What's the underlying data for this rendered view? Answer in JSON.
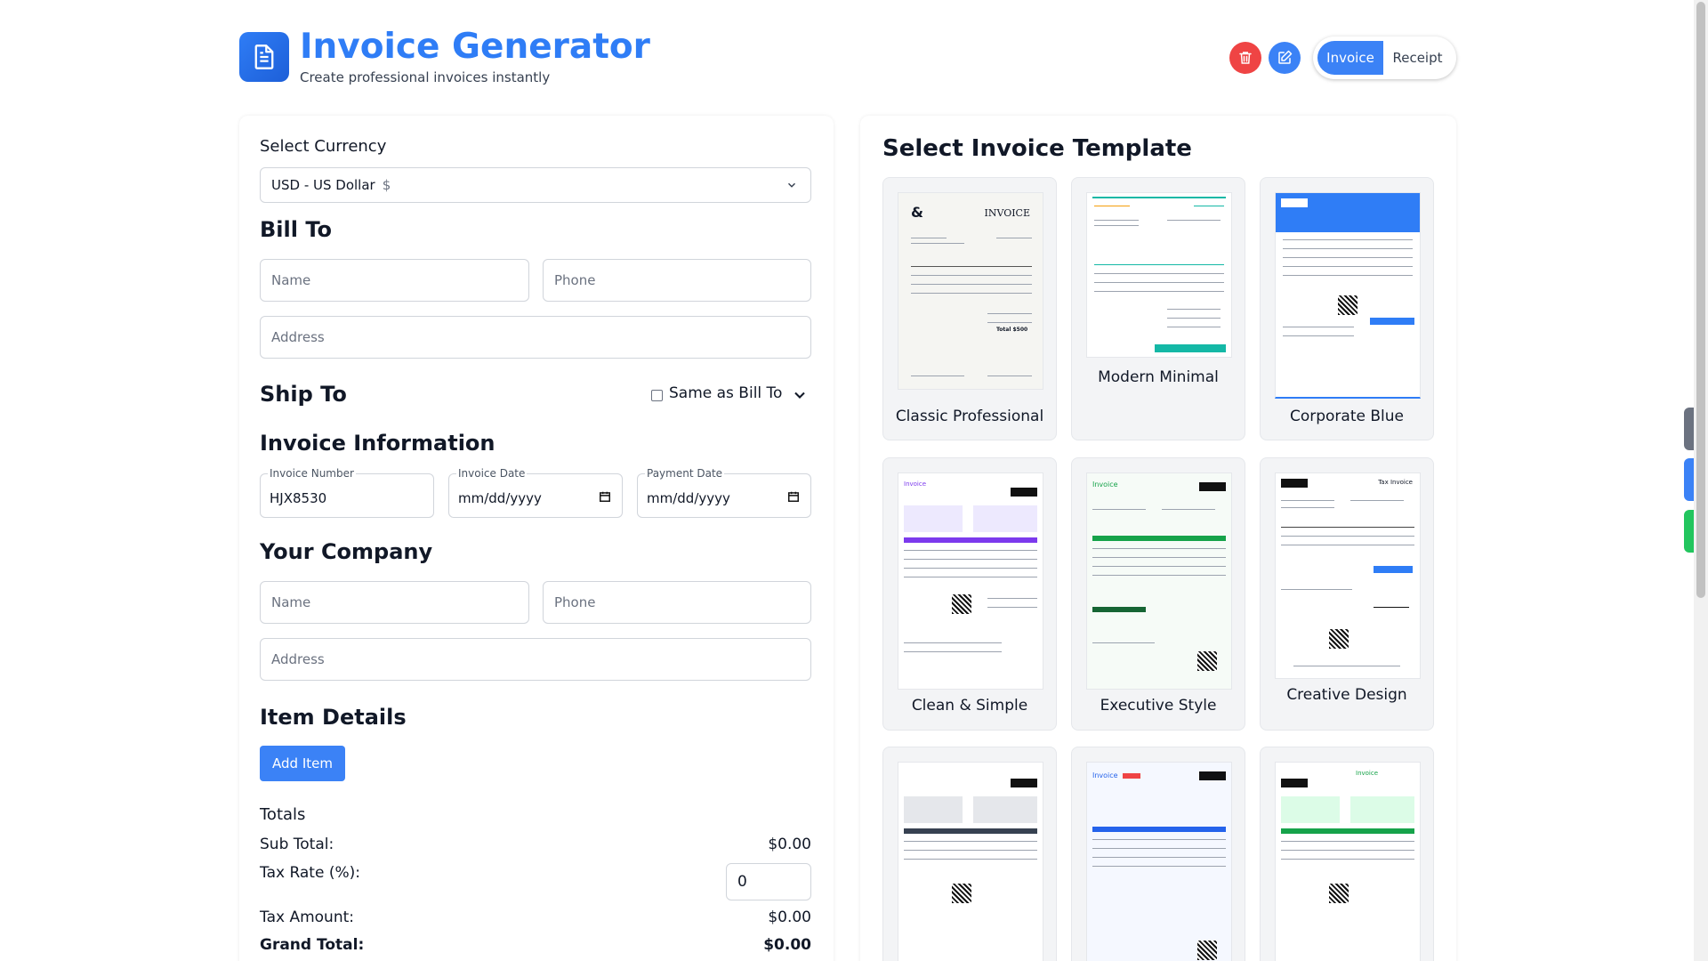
{
  "header": {
    "title": "Invoice Generator",
    "subtitle": "Create professional invoices instantly",
    "toggle": {
      "invoice": "Invoice",
      "receipt": "Receipt",
      "active": "Invoice"
    }
  },
  "form": {
    "currency_label": "Select Currency",
    "currency_value": "USD - US Dollar",
    "currency_symbol": "$",
    "bill_to": {
      "heading": "Bill To",
      "name_placeholder": "Name",
      "phone_placeholder": "Phone",
      "address_placeholder": "Address"
    },
    "ship_to": {
      "heading": "Ship To",
      "same_as_label": "Same as Bill To"
    },
    "invoice_info": {
      "heading": "Invoice Information",
      "number_label": "Invoice Number",
      "number_value": "HJX8530",
      "date_label": "Invoice Date",
      "date_value": "mm/dd/yyyy",
      "payment_label": "Payment Date",
      "payment_value": "mm/dd/yyyy"
    },
    "company": {
      "heading": "Your Company",
      "name_placeholder": "Name",
      "phone_placeholder": "Phone",
      "address_placeholder": "Address"
    },
    "items": {
      "heading": "Item Details",
      "add_button": "Add Item"
    },
    "totals": {
      "heading": "Totals",
      "subtotal_label": "Sub Total:",
      "subtotal_value": "$0.00",
      "tax_rate_label": "Tax Rate (%):",
      "tax_rate_value": "0",
      "tax_amount_label": "Tax Amount:",
      "tax_amount_value": "$0.00",
      "grand_total_label": "Grand Total:",
      "grand_total_value": "$0.00"
    }
  },
  "templates": {
    "heading": "Select Invoice Template",
    "items": [
      {
        "label": "Classic Professional"
      },
      {
        "label": "Modern Minimal"
      },
      {
        "label": "Corporate Blue"
      },
      {
        "label": "Clean & Simple"
      },
      {
        "label": "Executive Style"
      },
      {
        "label": "Creative Design"
      }
    ]
  },
  "colors": {
    "accent": "#3b82f6",
    "danger": "#ef4444",
    "title": "#2f7df6"
  },
  "icons": [
    "document-icon",
    "trash-icon",
    "edit-icon",
    "chevron-down-icon",
    "calendar-icon"
  ]
}
